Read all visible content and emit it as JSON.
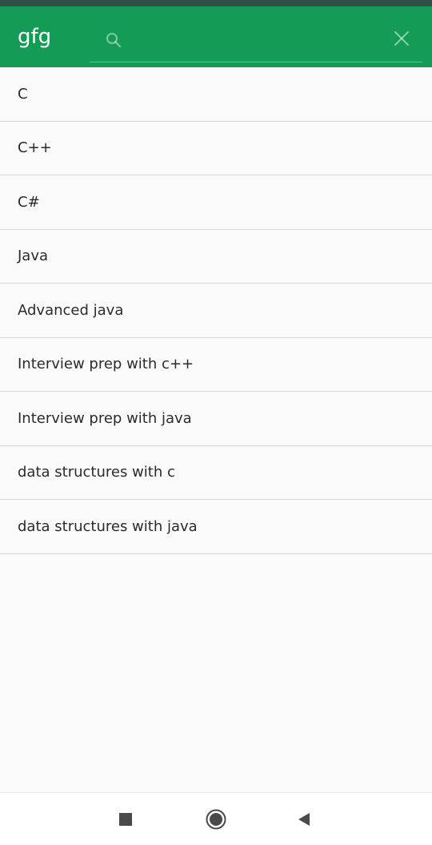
{
  "app_bar": {
    "title": "gfg",
    "search": {
      "value": "",
      "placeholder": ""
    },
    "background_color": "#149c57",
    "icons": {
      "search": "search-icon",
      "close": "close-icon"
    }
  },
  "list": {
    "items": [
      {
        "label": "C"
      },
      {
        "label": "C++"
      },
      {
        "label": "C#"
      },
      {
        "label": "Java"
      },
      {
        "label": "Advanced java"
      },
      {
        "label": "Interview prep with c++"
      },
      {
        "label": "Interview prep with java"
      },
      {
        "label": "data structures with c"
      },
      {
        "label": "data structures with java"
      }
    ]
  },
  "nav_bar": {
    "icons": [
      "recents-icon",
      "home-icon",
      "back-icon"
    ]
  }
}
